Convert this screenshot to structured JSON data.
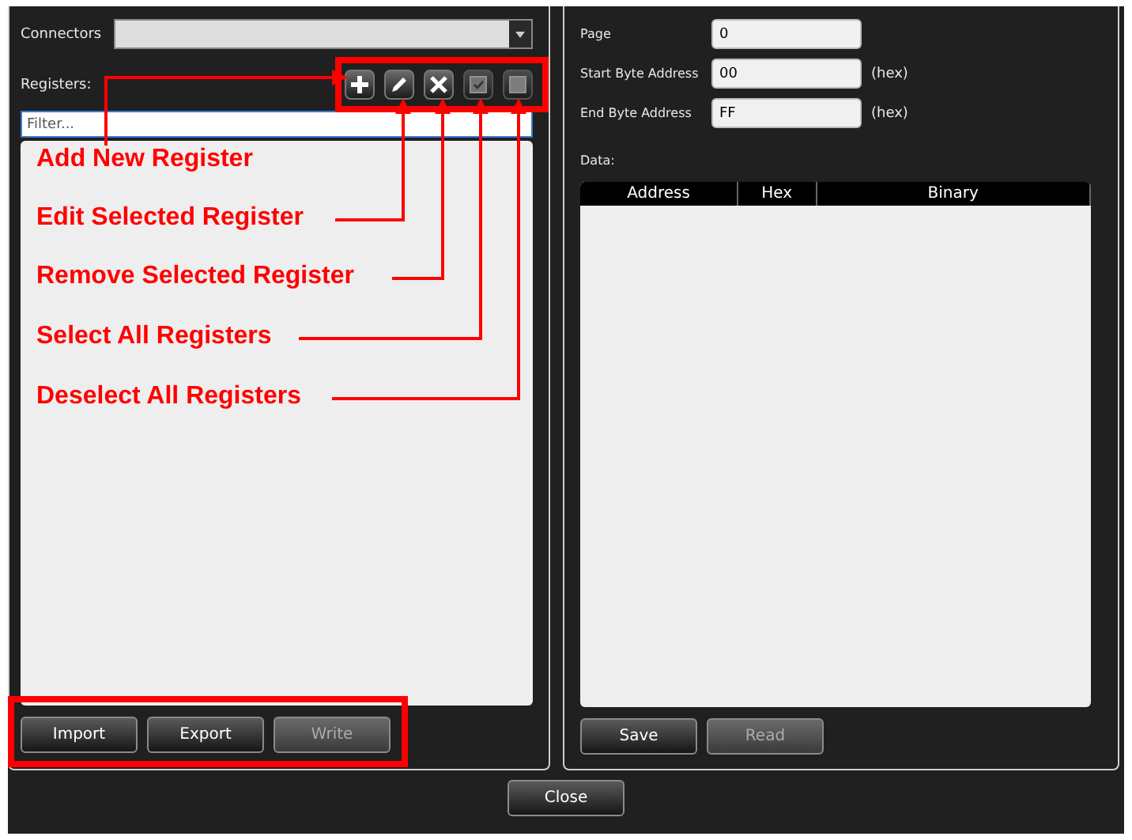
{
  "connectors": {
    "label": "Connectors"
  },
  "registers": {
    "label": "Registers:",
    "placeholder": "Filter...",
    "toolbar": [
      {
        "kind": "add",
        "disabled": false
      },
      {
        "kind": "edit",
        "disabled": false
      },
      {
        "kind": "remove",
        "disabled": false
      },
      {
        "kind": "select_all",
        "disabled": true
      },
      {
        "kind": "deselect_all",
        "disabled": true
      }
    ]
  },
  "left_buttons": [
    {
      "label": "Import",
      "disabled": false
    },
    {
      "label": "Export",
      "disabled": false
    },
    {
      "label": "Write",
      "disabled": true
    }
  ],
  "fields": [
    {
      "label": "Page",
      "value": "0"
    },
    {
      "label": "Start Byte Address",
      "value": "00",
      "unit": "(hex)"
    },
    {
      "label": "End Byte Address",
      "value": "FF",
      "unit": "(hex)"
    }
  ],
  "data": {
    "label": "Data:",
    "columns": [
      "Address",
      "Hex",
      "Binary"
    ]
  },
  "right_buttons": [
    {
      "label": "Save",
      "disabled": false
    },
    {
      "label": "Read",
      "disabled": true
    }
  ],
  "close_button": "Close",
  "annotations": [
    {
      "label": "Add New Register"
    },
    {
      "label": "Edit Selected Register"
    },
    {
      "label": "Remove Selected Register"
    },
    {
      "label": "Select All Registers"
    },
    {
      "label": "Deselect All Registers"
    }
  ]
}
